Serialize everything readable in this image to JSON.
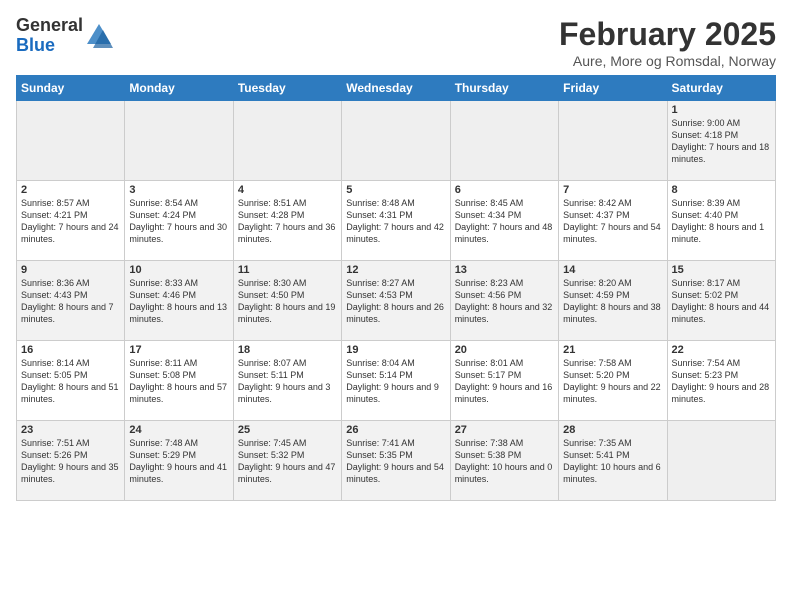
{
  "header": {
    "logo_general": "General",
    "logo_blue": "Blue",
    "title": "February 2025",
    "location": "Aure, More og Romsdal, Norway"
  },
  "days_of_week": [
    "Sunday",
    "Monday",
    "Tuesday",
    "Wednesday",
    "Thursday",
    "Friday",
    "Saturday"
  ],
  "weeks": [
    [
      {
        "num": "",
        "info": ""
      },
      {
        "num": "",
        "info": ""
      },
      {
        "num": "",
        "info": ""
      },
      {
        "num": "",
        "info": ""
      },
      {
        "num": "",
        "info": ""
      },
      {
        "num": "",
        "info": ""
      },
      {
        "num": "1",
        "info": "Sunrise: 9:00 AM\nSunset: 4:18 PM\nDaylight: 7 hours\nand 18 minutes."
      }
    ],
    [
      {
        "num": "2",
        "info": "Sunrise: 8:57 AM\nSunset: 4:21 PM\nDaylight: 7 hours\nand 24 minutes."
      },
      {
        "num": "3",
        "info": "Sunrise: 8:54 AM\nSunset: 4:24 PM\nDaylight: 7 hours\nand 30 minutes."
      },
      {
        "num": "4",
        "info": "Sunrise: 8:51 AM\nSunset: 4:28 PM\nDaylight: 7 hours\nand 36 minutes."
      },
      {
        "num": "5",
        "info": "Sunrise: 8:48 AM\nSunset: 4:31 PM\nDaylight: 7 hours\nand 42 minutes."
      },
      {
        "num": "6",
        "info": "Sunrise: 8:45 AM\nSunset: 4:34 PM\nDaylight: 7 hours\nand 48 minutes."
      },
      {
        "num": "7",
        "info": "Sunrise: 8:42 AM\nSunset: 4:37 PM\nDaylight: 7 hours\nand 54 minutes."
      },
      {
        "num": "8",
        "info": "Sunrise: 8:39 AM\nSunset: 4:40 PM\nDaylight: 8 hours\nand 1 minute."
      }
    ],
    [
      {
        "num": "9",
        "info": "Sunrise: 8:36 AM\nSunset: 4:43 PM\nDaylight: 8 hours\nand 7 minutes."
      },
      {
        "num": "10",
        "info": "Sunrise: 8:33 AM\nSunset: 4:46 PM\nDaylight: 8 hours\nand 13 minutes."
      },
      {
        "num": "11",
        "info": "Sunrise: 8:30 AM\nSunset: 4:50 PM\nDaylight: 8 hours\nand 19 minutes."
      },
      {
        "num": "12",
        "info": "Sunrise: 8:27 AM\nSunset: 4:53 PM\nDaylight: 8 hours\nand 26 minutes."
      },
      {
        "num": "13",
        "info": "Sunrise: 8:23 AM\nSunset: 4:56 PM\nDaylight: 8 hours\nand 32 minutes."
      },
      {
        "num": "14",
        "info": "Sunrise: 8:20 AM\nSunset: 4:59 PM\nDaylight: 8 hours\nand 38 minutes."
      },
      {
        "num": "15",
        "info": "Sunrise: 8:17 AM\nSunset: 5:02 PM\nDaylight: 8 hours\nand 44 minutes."
      }
    ],
    [
      {
        "num": "16",
        "info": "Sunrise: 8:14 AM\nSunset: 5:05 PM\nDaylight: 8 hours\nand 51 minutes."
      },
      {
        "num": "17",
        "info": "Sunrise: 8:11 AM\nSunset: 5:08 PM\nDaylight: 8 hours\nand 57 minutes."
      },
      {
        "num": "18",
        "info": "Sunrise: 8:07 AM\nSunset: 5:11 PM\nDaylight: 9 hours\nand 3 minutes."
      },
      {
        "num": "19",
        "info": "Sunrise: 8:04 AM\nSunset: 5:14 PM\nDaylight: 9 hours\nand 9 minutes."
      },
      {
        "num": "20",
        "info": "Sunrise: 8:01 AM\nSunset: 5:17 PM\nDaylight: 9 hours\nand 16 minutes."
      },
      {
        "num": "21",
        "info": "Sunrise: 7:58 AM\nSunset: 5:20 PM\nDaylight: 9 hours\nand 22 minutes."
      },
      {
        "num": "22",
        "info": "Sunrise: 7:54 AM\nSunset: 5:23 PM\nDaylight: 9 hours\nand 28 minutes."
      }
    ],
    [
      {
        "num": "23",
        "info": "Sunrise: 7:51 AM\nSunset: 5:26 PM\nDaylight: 9 hours\nand 35 minutes."
      },
      {
        "num": "24",
        "info": "Sunrise: 7:48 AM\nSunset: 5:29 PM\nDaylight: 9 hours\nand 41 minutes."
      },
      {
        "num": "25",
        "info": "Sunrise: 7:45 AM\nSunset: 5:32 PM\nDaylight: 9 hours\nand 47 minutes."
      },
      {
        "num": "26",
        "info": "Sunrise: 7:41 AM\nSunset: 5:35 PM\nDaylight: 9 hours\nand 54 minutes."
      },
      {
        "num": "27",
        "info": "Sunrise: 7:38 AM\nSunset: 5:38 PM\nDaylight: 10 hours\nand 0 minutes."
      },
      {
        "num": "28",
        "info": "Sunrise: 7:35 AM\nSunset: 5:41 PM\nDaylight: 10 hours\nand 6 minutes."
      },
      {
        "num": "",
        "info": ""
      }
    ]
  ]
}
